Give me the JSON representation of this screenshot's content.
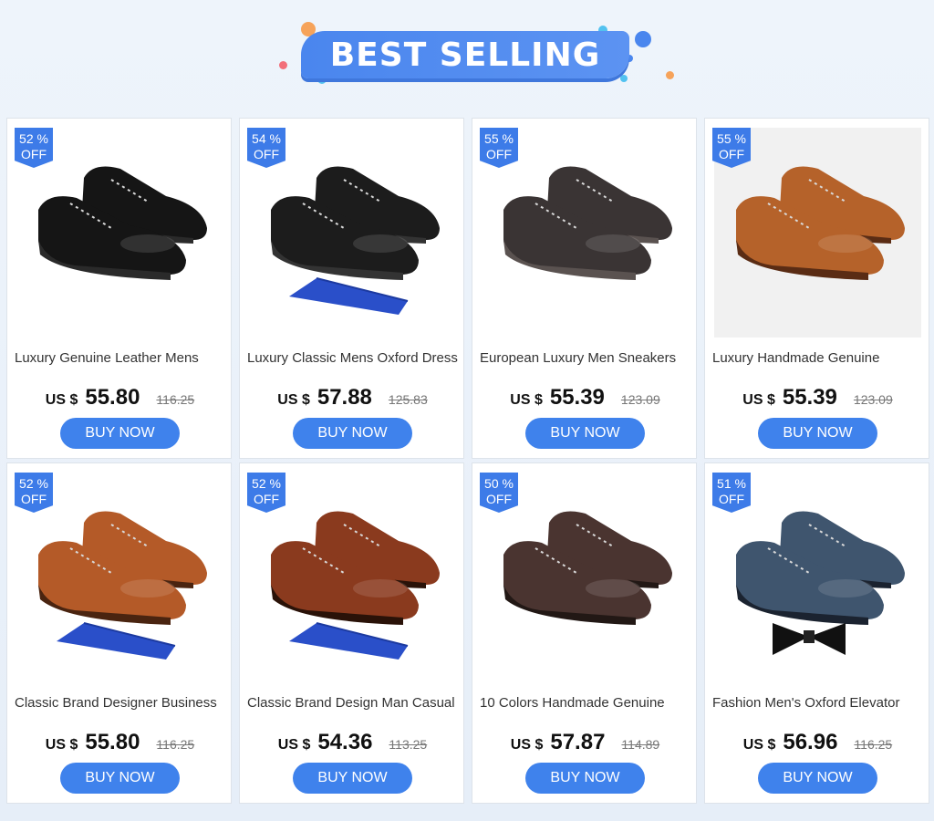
{
  "header": {
    "title": "BEST SELLING"
  },
  "colors": {
    "accent": "#3f82ec",
    "badge": "#3d7be8"
  },
  "products": [
    {
      "discount": "52 %",
      "off": "OFF",
      "title": "Luxury Genuine Leather Mens",
      "currency": "US $",
      "price": "55.80",
      "original": "116.25",
      "button": "BUY NOW",
      "shoe_color": "#151515",
      "accent": "#2a2a2a",
      "extra": "none",
      "bg": "white"
    },
    {
      "discount": "54 %",
      "off": "OFF",
      "title": "Luxury Classic Mens Oxford Dress",
      "currency": "US $",
      "price": "57.88",
      "original": "125.83",
      "button": "BUY NOW",
      "shoe_color": "#1c1c1c",
      "accent": "#333333",
      "extra": "tie",
      "bg": "white"
    },
    {
      "discount": "55 %",
      "off": "OFF",
      "title": "European Luxury Men Sneakers",
      "currency": "US $",
      "price": "55.39",
      "original": "123.09",
      "button": "BUY NOW",
      "shoe_color": "#3a3434",
      "accent": "#5a5250",
      "extra": "none",
      "bg": "white"
    },
    {
      "discount": "55 %",
      "off": "OFF",
      "title": "Luxury Handmade Genuine",
      "currency": "US $",
      "price": "55.39",
      "original": "123.09",
      "button": "BUY NOW",
      "shoe_color": "#b5622a",
      "accent": "#5a2c14",
      "extra": "none",
      "bg": "grey"
    },
    {
      "discount": "52 %",
      "off": "OFF",
      "title": "Classic Brand Designer Business",
      "currency": "US $",
      "price": "55.80",
      "original": "116.25",
      "button": "BUY NOW",
      "shoe_color": "#b45a28",
      "accent": "#4a2410",
      "extra": "tie",
      "bg": "white"
    },
    {
      "discount": "52 %",
      "off": "OFF",
      "title": "Classic Brand Design Man Casual",
      "currency": "US $",
      "price": "54.36",
      "original": "113.25",
      "button": "BUY NOW",
      "shoe_color": "#8a3a1e",
      "accent": "#2a1208",
      "extra": "tie",
      "bg": "white"
    },
    {
      "discount": "50 %",
      "off": "OFF",
      "title": "10 Colors Handmade Genuine",
      "currency": "US $",
      "price": "57.87",
      "original": "114.89",
      "button": "BUY NOW",
      "shoe_color": "#4a3430",
      "accent": "#221815",
      "extra": "none",
      "bg": "white"
    },
    {
      "discount": "51 %",
      "off": "OFF",
      "title": "Fashion Men's Oxford Elevator",
      "currency": "US $",
      "price": "56.96",
      "original": "116.25",
      "button": "BUY NOW",
      "shoe_color": "#3f556e",
      "accent": "#1b2330",
      "extra": "bowtie",
      "bg": "white"
    }
  ]
}
